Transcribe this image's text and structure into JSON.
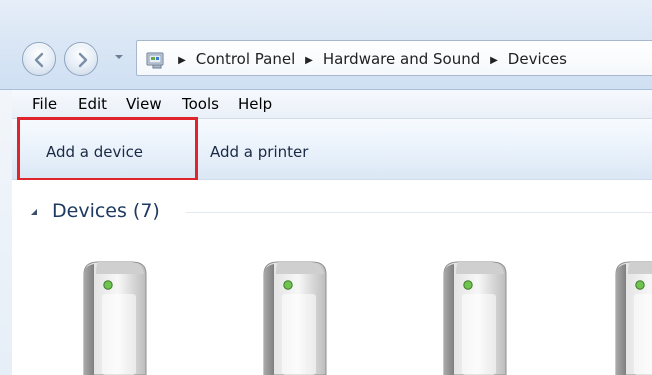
{
  "address_bar": {
    "breadcrumbs": [
      "Control Panel",
      "Hardware and Sound",
      "Devices"
    ]
  },
  "menubar": {
    "items": [
      "File",
      "Edit",
      "View",
      "Tools",
      "Help"
    ]
  },
  "commandbar": {
    "add_device": "Add a device",
    "add_printer": "Add a printer"
  },
  "content": {
    "group_header": "Devices (7)",
    "devices_visible": 4
  },
  "colors": {
    "accent_highlight": "#e0242b",
    "header_text": "#1e3a60",
    "chrome_bg": "#d9e6f5"
  },
  "icons": [
    "back-arrow-icon",
    "forward-arrow-icon",
    "control-panel-icon",
    "chevron-right-icon",
    "collapse-caret-icon",
    "device-tower-icon"
  ]
}
